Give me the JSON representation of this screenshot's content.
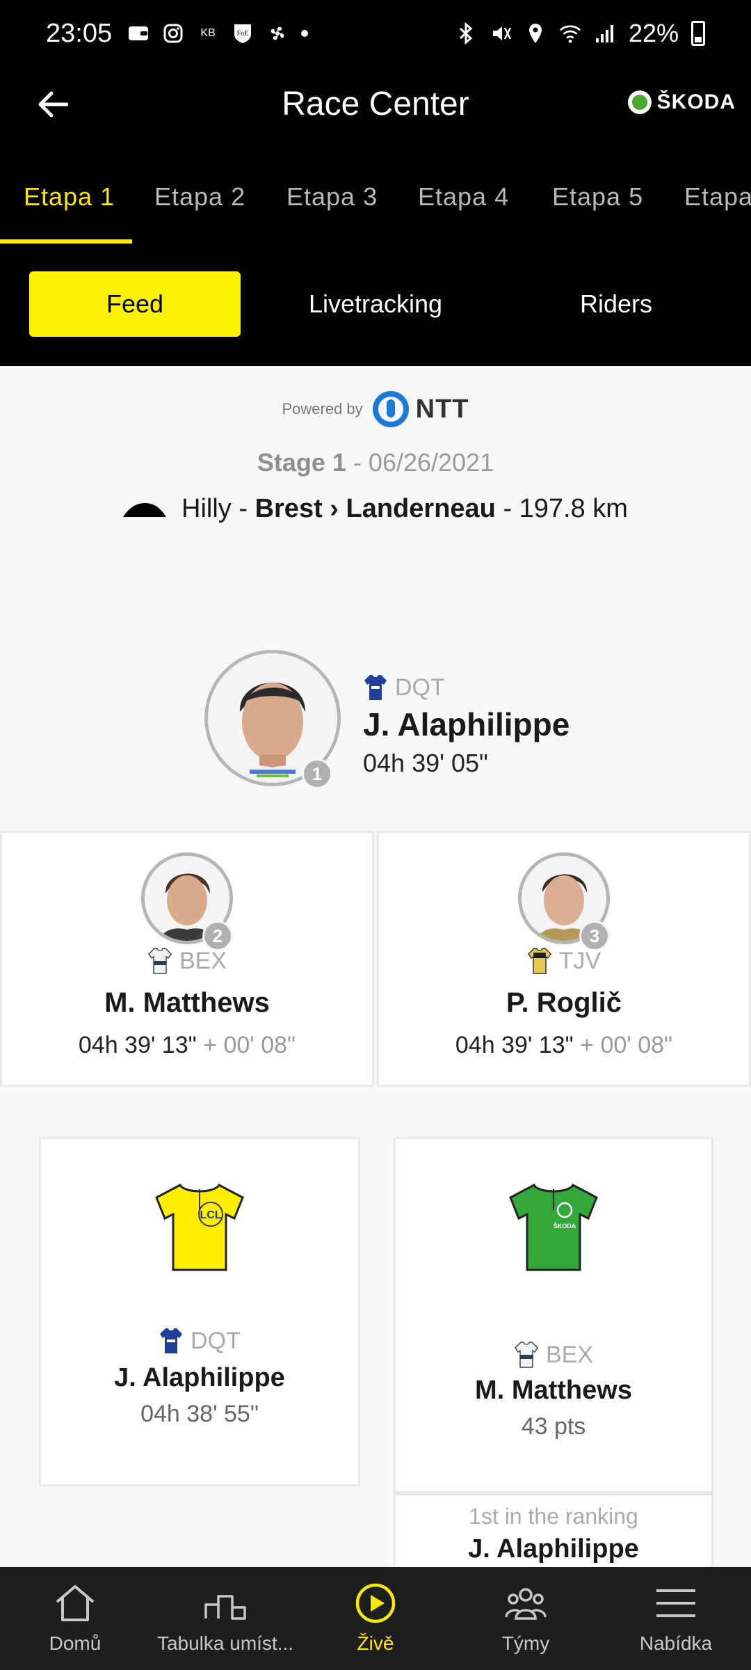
{
  "status_bar": {
    "time": "23:05",
    "left_icons": [
      "wallet-icon",
      "instagram-icon",
      "kb-icon",
      "foe-icon",
      "fan-icon",
      "dot-icon"
    ],
    "kb_text": "KB",
    "foe_text": "FoE",
    "battery": "22%"
  },
  "header": {
    "title": "Race Center",
    "brand": "ŠKODA"
  },
  "stage_tabs": [
    {
      "label": "Etapa 1",
      "active": true
    },
    {
      "label": "Etapa 2"
    },
    {
      "label": "Etapa 3"
    },
    {
      "label": "Etapa 4"
    },
    {
      "label": "Etapa 5"
    },
    {
      "label": "Etapa"
    }
  ],
  "segment": {
    "feed": "Feed",
    "livetracking": "Livetracking",
    "riders": "Riders"
  },
  "feed": {
    "powered_by": "Powered by",
    "sponsor": "NTT",
    "stage_label": "Stage 1",
    "stage_date": " - 06/26/2021",
    "profile": "Hilly",
    "route": "Brest › Landerneau",
    "distance": " - 197.8 km",
    "sep": " - "
  },
  "winner": {
    "rank": "1",
    "team": "DQT",
    "name": "J. Alaphilippe",
    "time": "04h 39' 05\""
  },
  "podium": [
    {
      "rank": "2",
      "team": "BEX",
      "name": "M. Matthews",
      "time": "04h 39' 13\"",
      "gap": " + 00' 08\""
    },
    {
      "rank": "3",
      "team": "TJV",
      "name": "P. Roglič",
      "time": "04h 39' 13\"",
      "gap": " + 00' 08\""
    }
  ],
  "jerseys": [
    {
      "team": "DQT",
      "name": "J. Alaphilippe",
      "value": "04h 38' 55\"",
      "color": "#ffee00",
      "sponsor": "LCL"
    },
    {
      "team": "BEX",
      "name": "M. Matthews",
      "value": "43 pts",
      "color": "#33a83a",
      "sponsor": "ŠKODA"
    }
  ],
  "ranking": {
    "label": "1st in the ranking",
    "name": "J. Alaphilippe"
  },
  "bottom_nav": [
    {
      "label": "Domů",
      "icon": "home-icon"
    },
    {
      "label": "Tabulka umíst...",
      "icon": "podium-icon"
    },
    {
      "label": "Živě",
      "icon": "play-icon",
      "active": true
    },
    {
      "label": "Týmy",
      "icon": "team-icon"
    },
    {
      "label": "Nabídka",
      "icon": "menu-icon"
    }
  ],
  "colors": {
    "accent_yellow": "#ffe800",
    "header_bg": "#000000",
    "ntt_blue": "#1b7bd6"
  }
}
